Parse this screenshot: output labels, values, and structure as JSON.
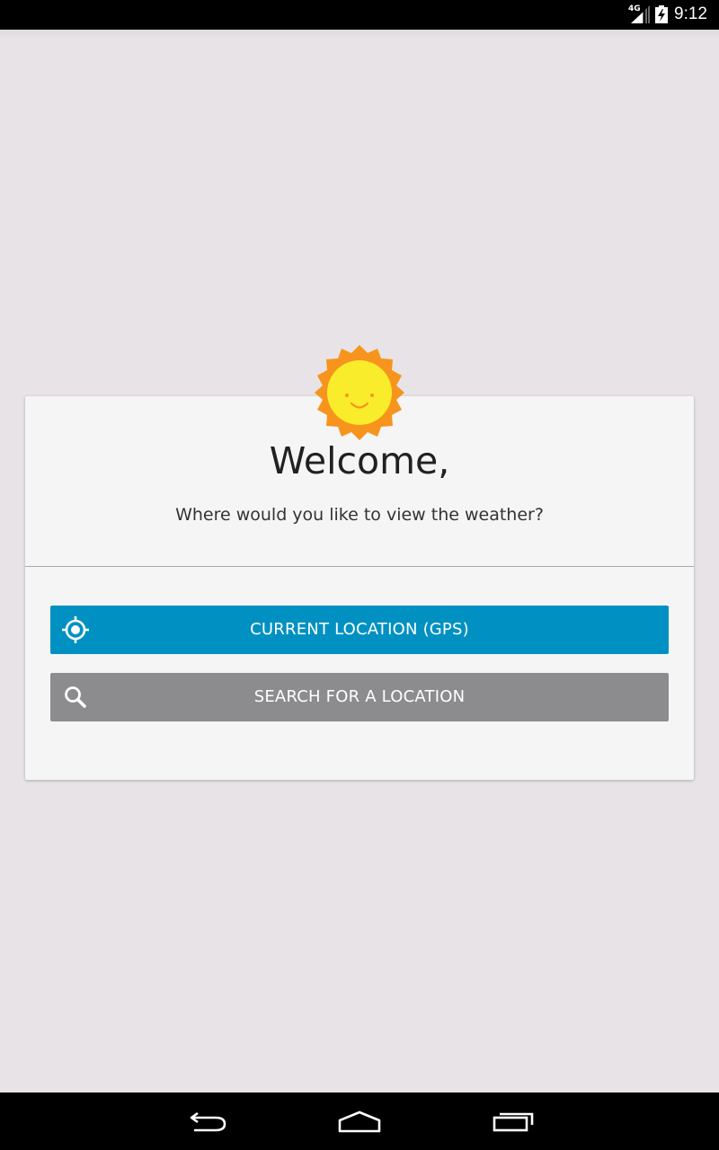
{
  "status_bar": {
    "network": "4G",
    "time": "9:12",
    "icons": [
      "signal-icon",
      "battery-charging-icon"
    ]
  },
  "card": {
    "logo_icon": "smiling-sun-icon",
    "title": "Welcome,",
    "subtitle": "Where would you like to view the weather?",
    "buttons": {
      "gps": {
        "label": "CURRENT LOCATION (GPS)",
        "icon": "gps-locate-icon",
        "color": "#0091c2"
      },
      "search": {
        "label": "SEARCH FOR A LOCATION",
        "icon": "search-icon",
        "color": "#8c8b8d"
      }
    }
  },
  "nav_bar": {
    "items": [
      "back-icon",
      "home-icon",
      "recents-icon"
    ]
  },
  "colors": {
    "background": "#e7e3e6",
    "card": "#f5f5f5",
    "sun_outer": "#f7941d",
    "sun_inner": "#f9ec2a"
  }
}
